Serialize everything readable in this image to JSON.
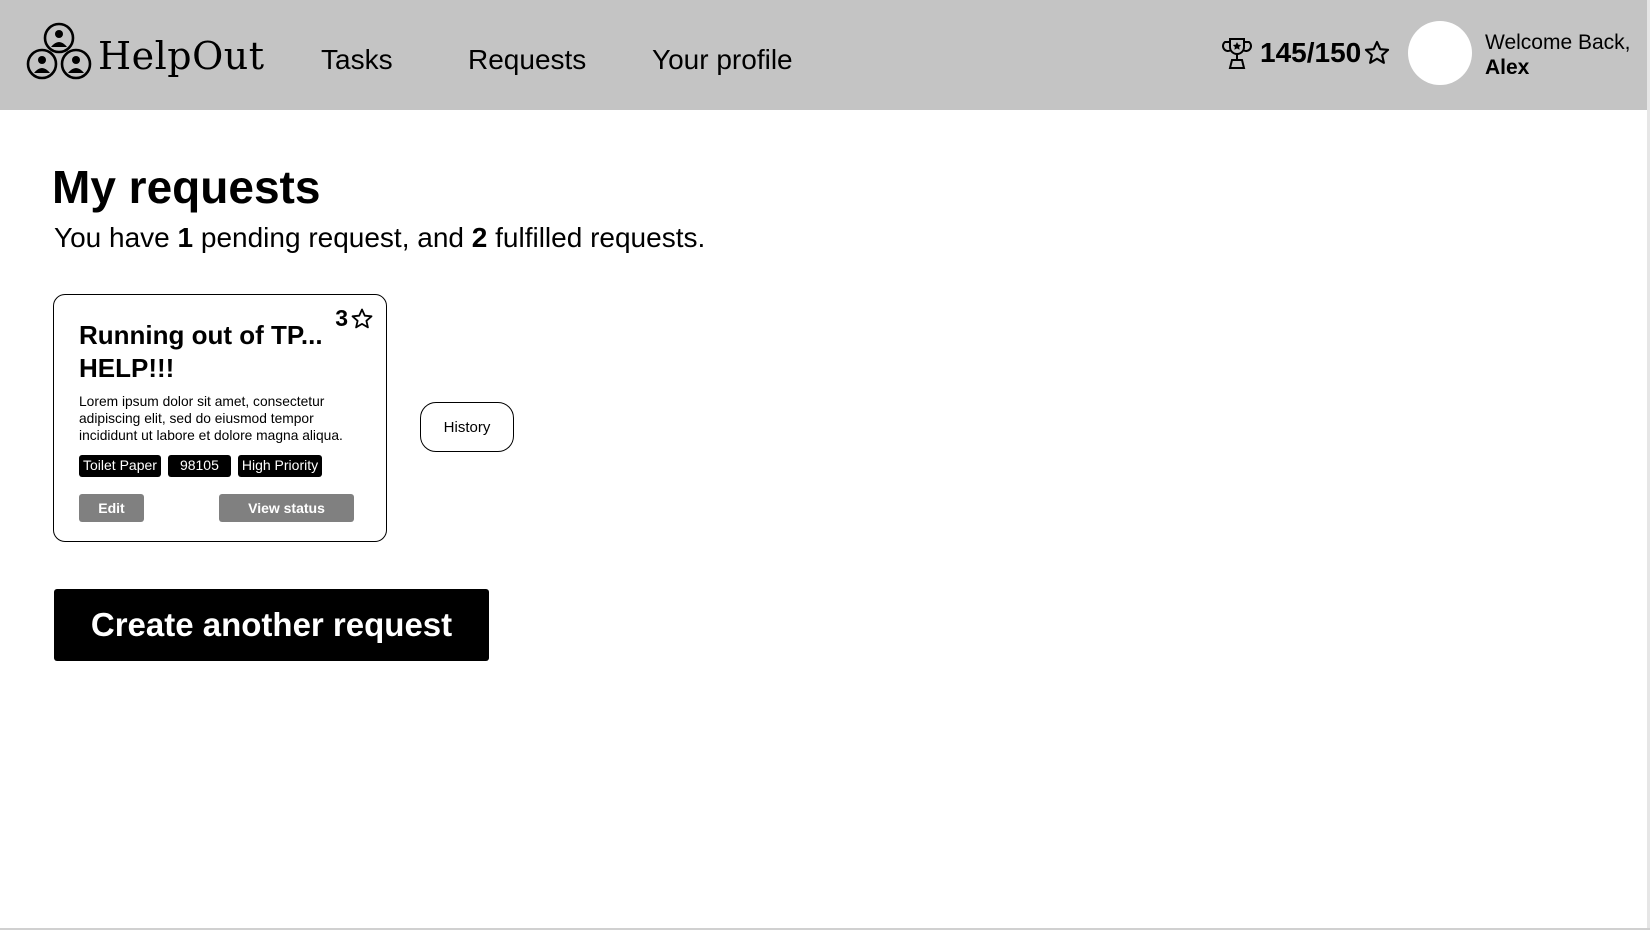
{
  "app": {
    "name": "HelpOut"
  },
  "header": {
    "nav": {
      "tasks": "Tasks",
      "requests": "Requests",
      "profile": "Your profile"
    },
    "points": "145/150",
    "welcome_line": "Welcome Back,",
    "user_name": "Alex",
    "icons": [
      "logo-people-icon",
      "trophy-icon",
      "star-icon"
    ]
  },
  "main": {
    "title": "My requests",
    "summary": {
      "prefix": "You have ",
      "pending_count": "1",
      "middle": " pending request, and ",
      "fulfilled_count": "2",
      "suffix": " fulfilled requests."
    },
    "card": {
      "points": "3",
      "title": "Running out of TP... HELP!!!",
      "body": "Lorem ipsum dolor sit amet, consectetur adipiscing elit, sed do eiusmod tempor incididunt ut labore et dolore magna aliqua.",
      "tags": [
        "Toilet Paper",
        "98105",
        "High Priority"
      ],
      "edit_label": "Edit",
      "status_label": "View status"
    },
    "history_label": "History",
    "create_label": "Create another request"
  },
  "colors": {
    "header_bg": "#c4c4c4",
    "button_grey": "#808080",
    "primary": "#000000"
  }
}
